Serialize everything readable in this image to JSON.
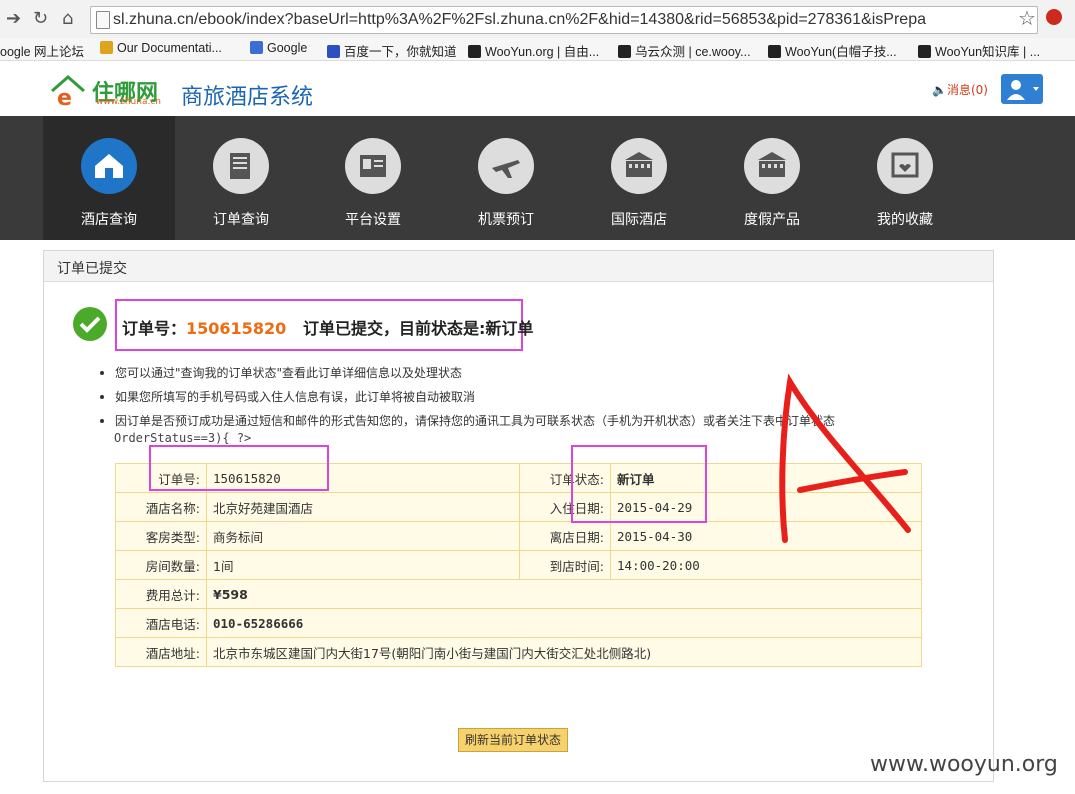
{
  "browser": {
    "url": "sl.zhuna.cn/ebook/index?baseUrl=http%3A%2F%2Fsl.zhuna.cn%2F&hid=14380&rid=56853&pid=278361&isPrepa",
    "bookmarks": [
      "oogle 网上论坛",
      "Our Documentati...",
      "Google",
      "百度一下，你就知道",
      "WooYun.org | 自由...",
      "乌云众测 | ce.wooy...",
      "WooYun(白帽子技...",
      "WooYun知识库 | ..."
    ]
  },
  "header": {
    "logo_name": "住哪网",
    "logo_url": "www.zhuna.cn",
    "system_title": "商旅酒店系统",
    "messages": "消息(0)"
  },
  "nav": {
    "items": [
      {
        "label": "酒店查询",
        "icon": "house-icon"
      },
      {
        "label": "订单查询",
        "icon": "document-icon"
      },
      {
        "label": "平台设置",
        "icon": "id-card-icon"
      },
      {
        "label": "机票预订",
        "icon": "airplane-icon"
      },
      {
        "label": "国际酒店",
        "icon": "building-icon"
      },
      {
        "label": "度假产品",
        "icon": "building-icon"
      },
      {
        "label": "我的收藏",
        "icon": "favorites-icon"
      }
    ]
  },
  "panel": {
    "title": "订单已提交",
    "order_prefix": "订单号：",
    "order_number": "150615820",
    "order_status_text": "订单已提交，目前状态是:新订单",
    "bullets": [
      "您可以通过\"查询我的订单状态\"查看此订单详细信息以及处理状态",
      "如果您所填写的手机号码或入住人信息有误，此订单将被自动被取消",
      "因订单是否预订成功是通过短信和邮件的形式告知您的，请保持您的通讯工具为可联系状态（手机为开机状态）或者关注下表中订单状态"
    ],
    "code_line": "OrderStatus==3){ ?>",
    "table": {
      "order_no_label": "订单号:",
      "order_no": "150615820",
      "status_label": "订单状态:",
      "status": "新订单",
      "hotel_label": "酒店名称:",
      "hotel": "北京好苑建国酒店",
      "checkin_label": "入住日期:",
      "checkin": "2015-04-29",
      "room_label": "客房类型:",
      "room": "商务标间",
      "checkout_label": "离店日期:",
      "checkout": "2015-04-30",
      "count_label": "房间数量:",
      "count": "1间",
      "arrive_label": "到店时间:",
      "arrive": "14:00-20:00",
      "total_label": "费用总计:",
      "total": "¥598",
      "phone_label": "酒店电话:",
      "phone": "010-65286666",
      "address_label": "酒店地址:",
      "address": "北京市东城区建国门内大街17号(朝阳门南小街与建国门内大街交汇处北侧路北)"
    },
    "refresh_button": "刷新当前订单状态"
  },
  "watermark": "www.wooyun.org",
  "colors": {
    "accent": "#1f76c8",
    "order_number": "#f06a12",
    "highlight": "#d946d9",
    "status_red": "#e0341b"
  }
}
